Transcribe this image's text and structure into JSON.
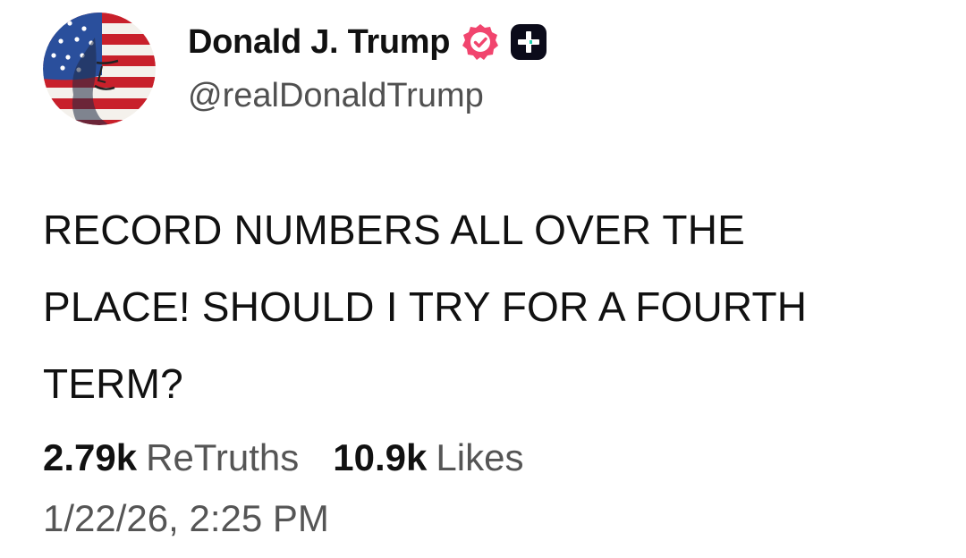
{
  "profile": {
    "display_name": "Donald J. Trump",
    "handle": "@realDonaldTrump",
    "avatar_icon": "flag-portrait-avatar",
    "verified_icon": "verified-badge-icon",
    "badge_icon": "plus-badge-icon"
  },
  "post": {
    "text": "RECORD NUMBERS ALL OVER THE PLACE! SHOULD I TRY FOR A FOURTH TERM?"
  },
  "stats": {
    "retruths_count": "2.79k",
    "retruths_label": "ReTruths",
    "likes_count": "10.9k",
    "likes_label": "Likes"
  },
  "timestamp": "1/22/26, 2:25 PM",
  "colors": {
    "verified": "#F1456E",
    "badge": "#0B0B1A",
    "text": "#111111",
    "muted": "#555555"
  }
}
